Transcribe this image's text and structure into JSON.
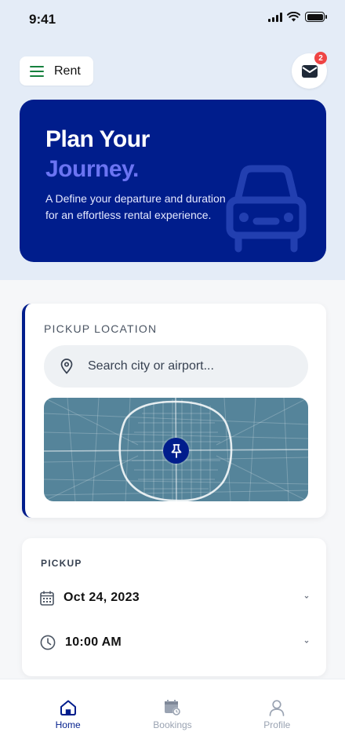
{
  "status_bar": {
    "time": "9:41"
  },
  "header": {
    "menu_label": "Rent",
    "notification_count": "2"
  },
  "hero": {
    "title_line1": "Plan Your",
    "title_line2": "Journey.",
    "description": "A Define your departure and duration for an effortless rental experience."
  },
  "pickup_location": {
    "label": "PICKUP LOCATION",
    "search_placeholder": "Search city or airport..."
  },
  "pickup": {
    "label": "PICKUP",
    "date": "Oct 24, 2023",
    "time": "10:00 AM"
  },
  "nav": {
    "items": [
      {
        "label": "Home",
        "icon": "home-icon",
        "active": true
      },
      {
        "label": "Bookings",
        "icon": "calendar-clock-icon",
        "active": false
      },
      {
        "label": "Profile",
        "icon": "user-icon",
        "active": false
      }
    ]
  },
  "colors": {
    "brand": "#001d8c",
    "accent": "#6b74f2",
    "badge": "#ef4444",
    "menu_icon": "#15803d"
  }
}
